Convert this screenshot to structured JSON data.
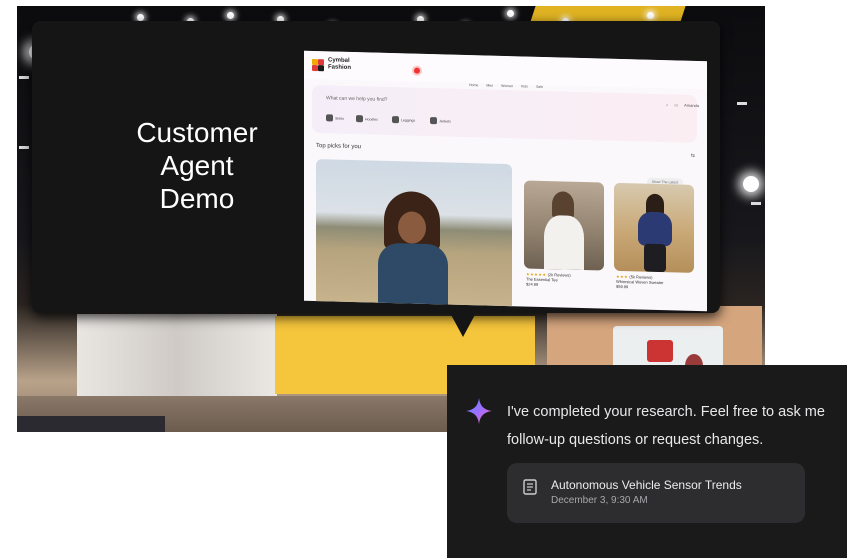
{
  "stage": {
    "demo_title_lines": [
      "Customer",
      "Agent",
      "Demo"
    ]
  },
  "website": {
    "brand": "Cymbal Fashion",
    "nav": [
      "Home",
      "Men",
      "Women",
      "Kids",
      "Sale"
    ],
    "search_placeholder": "What can we help you find?",
    "chips": [
      "Shirts",
      "Hoodies",
      "Leggings",
      "Jackets"
    ],
    "account": "Amanda",
    "section_title": "Top picks for you",
    "show_latest": "Show The Latest",
    "products": [
      {
        "name": "The Essential Tee",
        "price": "$24.99",
        "rating": "★★★★★",
        "reviews": "(2k Reviews)"
      },
      {
        "name": "Whimsical Woven Sweater",
        "price": "$59.99",
        "rating": "★★★",
        "reviews": "(5k Reviews)"
      }
    ]
  },
  "chat": {
    "message_line1": "I've completed your research. Feel free to ask me",
    "message_line2": "follow-up questions or request changes.",
    "doc_title": "Autonomous Vehicle Sensor Trends",
    "doc_date": "December 3, 9:30 AM",
    "icons": {
      "assistant": "gemini-sparkle-icon",
      "document": "document-icon"
    }
  }
}
